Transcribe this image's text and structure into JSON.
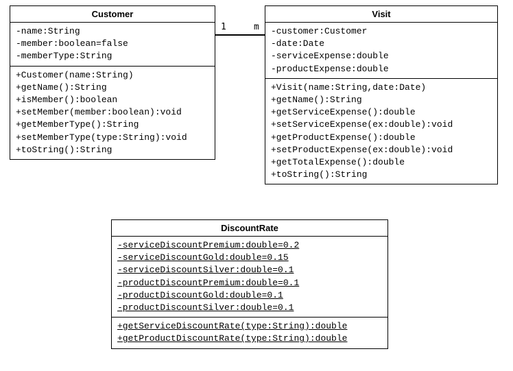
{
  "customer": {
    "title": "Customer",
    "attrs": [
      "-name:String",
      "-member:boolean=false",
      "-memberType:String"
    ],
    "ops": [
      "+Customer(name:String)",
      "+getName():String",
      "+isMember():boolean",
      "+setMember(member:boolean):void",
      "+getMemberType():String",
      "+setMemberType(type:String):void",
      "+toString():String"
    ]
  },
  "visit": {
    "title": "Visit",
    "attrs": [
      "-customer:Customer",
      "-date:Date",
      "-serviceExpense:double",
      "-productExpense:double"
    ],
    "ops": [
      "+Visit(name:String,date:Date)",
      "+getName():String",
      "+getServiceExpense():double",
      "+setServiceExpense(ex:double):void",
      "+getProductExpense():double",
      "+setProductExpense(ex:double):void",
      "+getTotalExpense():double",
      "+toString():String"
    ]
  },
  "discount": {
    "title": "DiscountRate",
    "attrs": [
      "-serviceDiscountPremium:double=0.2",
      "-serviceDiscountGold:double=0.15",
      "-serviceDiscountSilver:double=0.1",
      "-productDiscountPremium:double=0.1",
      "-productDiscountGold:double=0.1",
      "-productDiscountSilver:double=0.1"
    ],
    "ops": [
      "+getServiceDiscountRate(type:String):double",
      "+getProductDiscountRate(type:String):double"
    ]
  },
  "assoc": {
    "left_mult": "1",
    "right_mult": "m"
  }
}
